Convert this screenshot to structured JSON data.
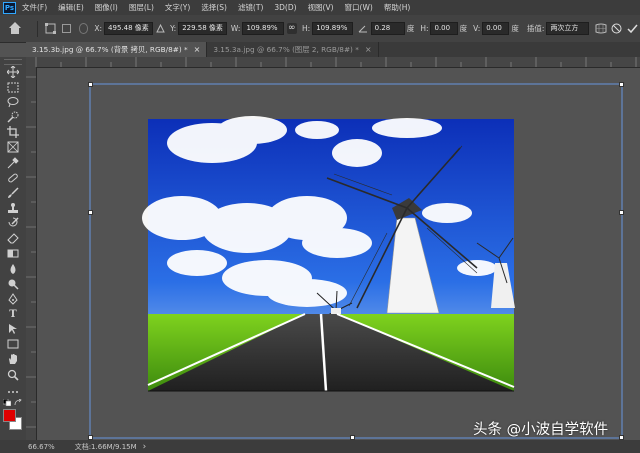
{
  "app": {
    "logo": "Ps"
  },
  "menu": [
    "文件(F)",
    "编辑(E)",
    "图像(I)",
    "图层(L)",
    "文字(Y)",
    "选择(S)",
    "滤镜(T)",
    "3D(D)",
    "视图(V)",
    "窗口(W)",
    "帮助(H)"
  ],
  "options": {
    "x_label": "X:",
    "x_value": "495.48 像素",
    "y_label": "Y:",
    "y_value": "229.58 像素",
    "w_label": "W:",
    "w_value": "109.89%",
    "link_symbol": "∞",
    "h_label": "H:",
    "h_value": "109.89%",
    "rotate_value": "0.28",
    "rotate_unit": "度",
    "hskew_label": "H:",
    "hskew_value": "0.00",
    "hskew_unit": "度",
    "vskew_label": "V:",
    "vskew_value": "0.00",
    "vskew_unit": "度",
    "interp_label": "插值:",
    "interp_value": "两次立方"
  },
  "tabs": [
    {
      "label": "3.15.3b.jpg @ 66.7% (背景 拷贝, RGB/8#) *",
      "close": "×"
    },
    {
      "label": "3.15.3a.jpg @ 66.7% (图层 2, RGB/8#) *",
      "close": "×"
    }
  ],
  "status": {
    "zoom": "66.67%",
    "doc": "文档:1.66M/9.15M"
  },
  "watermark": "头条 @小波自学软件",
  "colors": {
    "foreground": "#e00000",
    "background": "#ffffff",
    "accent": "#31a8ff"
  },
  "tools": [
    "move-icon",
    "marquee-icon",
    "lasso-icon",
    "quick-select-icon",
    "crop-icon",
    "frame-icon",
    "eyedropper-icon",
    "healing-icon",
    "brush-icon",
    "stamp-icon",
    "history-brush-icon",
    "eraser-icon",
    "gradient-icon",
    "blur-icon",
    "dodge-icon",
    "pen-icon",
    "type-icon",
    "path-select-icon",
    "shape-icon",
    "hand-icon",
    "zoom-icon",
    "more-icon"
  ],
  "tool_letters": {
    "type": "T"
  }
}
